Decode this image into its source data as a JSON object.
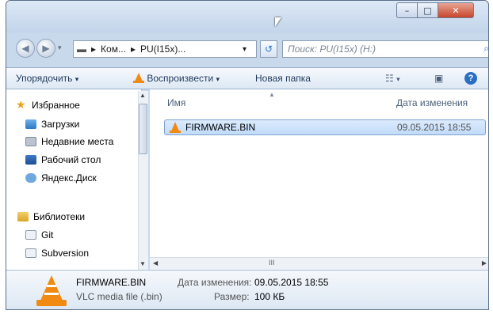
{
  "window": {
    "minimize_glyph": "–",
    "maximize_glyph": "□",
    "close_glyph": "✕"
  },
  "navigation": {
    "back_icon": "back-arrow",
    "forward_icon": "forward-arrow",
    "address": {
      "drive_glyph": "▬",
      "sep_glyph": "▸",
      "segments": [
        "Ком...",
        "PU(I15x)..."
      ],
      "dropdown": "▾"
    },
    "refresh_glyph": "↺",
    "search_placeholder": "Поиск: PU(I15x) (H:)",
    "search_glyph": "⌕"
  },
  "toolbar": {
    "organize": "Упорядочить",
    "play": "Воспроизвести",
    "new_folder": "Новая папка",
    "caret": "▾",
    "views_glyph": "☷",
    "pane_glyph": "▣",
    "help_glyph": "?"
  },
  "nav_pane": {
    "favorites_title": "Избранное",
    "favorites": [
      "Загрузки",
      "Недавние места",
      "Рабочий стол",
      "Яндекс.Диск"
    ],
    "libraries_title": "Библиотеки",
    "libraries": [
      "Git",
      "Subversion"
    ]
  },
  "columns": {
    "name": "Имя",
    "date": "Дата изменения"
  },
  "files": [
    {
      "name": "FIRMWARE.BIN",
      "date": "09.05.2015 18:55"
    }
  ],
  "hscroll_mark": "III",
  "details": {
    "filename": "FIRMWARE.BIN",
    "type": "VLC media file (.bin)",
    "date_label": "Дата изменения:",
    "date_value": "09.05.2015 18:55",
    "size_label": "Размер:",
    "size_value": "100 КБ"
  },
  "colors": {
    "accent": "#2a73c9",
    "vlc_orange": "#f08a12",
    "close_red": "#c7452b"
  }
}
